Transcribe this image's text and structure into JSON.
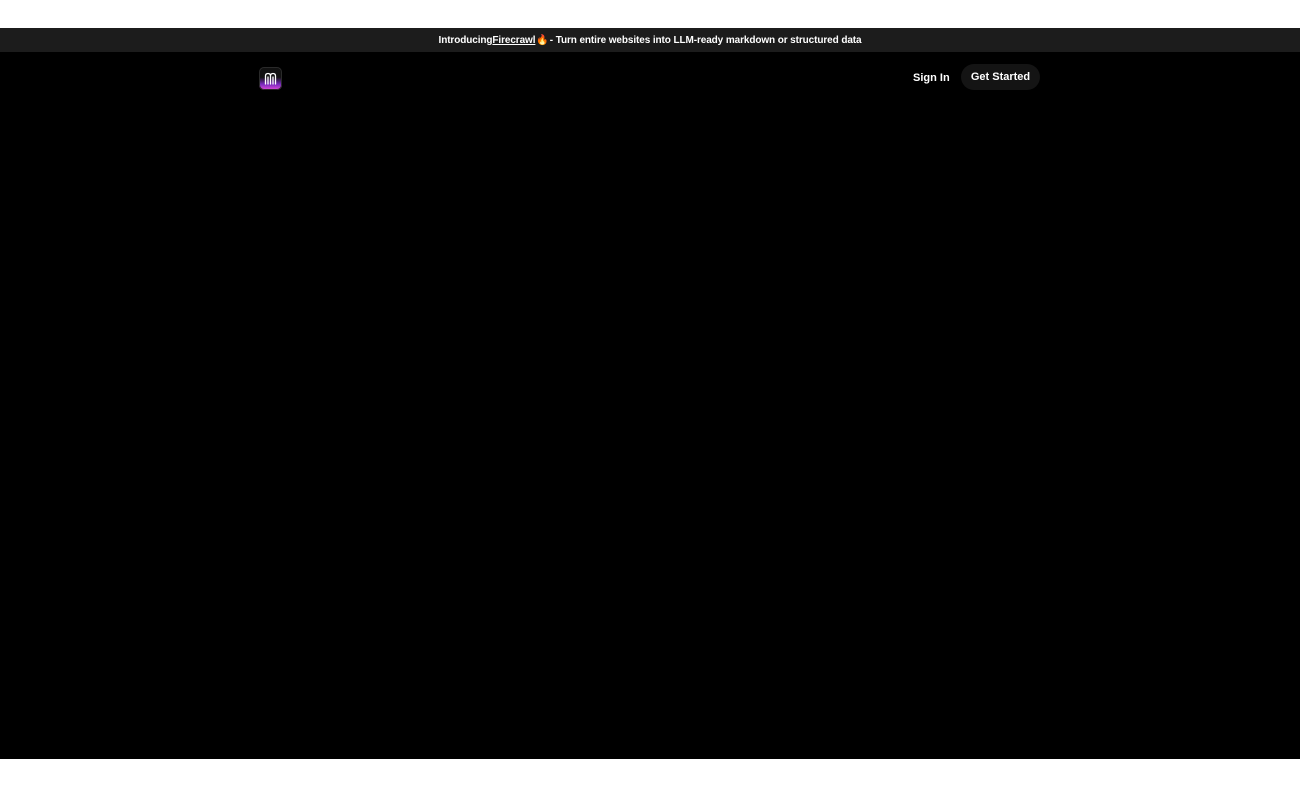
{
  "announcement": {
    "prefix": "Introducing ",
    "link_text": "Firecrawl",
    "emoji": "🔥",
    "suffix": " - Turn entire websites into LLM-ready markdown or structured data"
  },
  "header": {
    "logo_icon": "m-logo-icon",
    "signin_label": "Sign In",
    "get_started_label": "Get Started"
  },
  "colors": {
    "page_background": "#000000",
    "announcement_background": "#1c1c1c",
    "button_background": "#141414",
    "logo_gradient_top": "#7a2bbf",
    "logo_gradient_bottom": "#e24bd8"
  }
}
